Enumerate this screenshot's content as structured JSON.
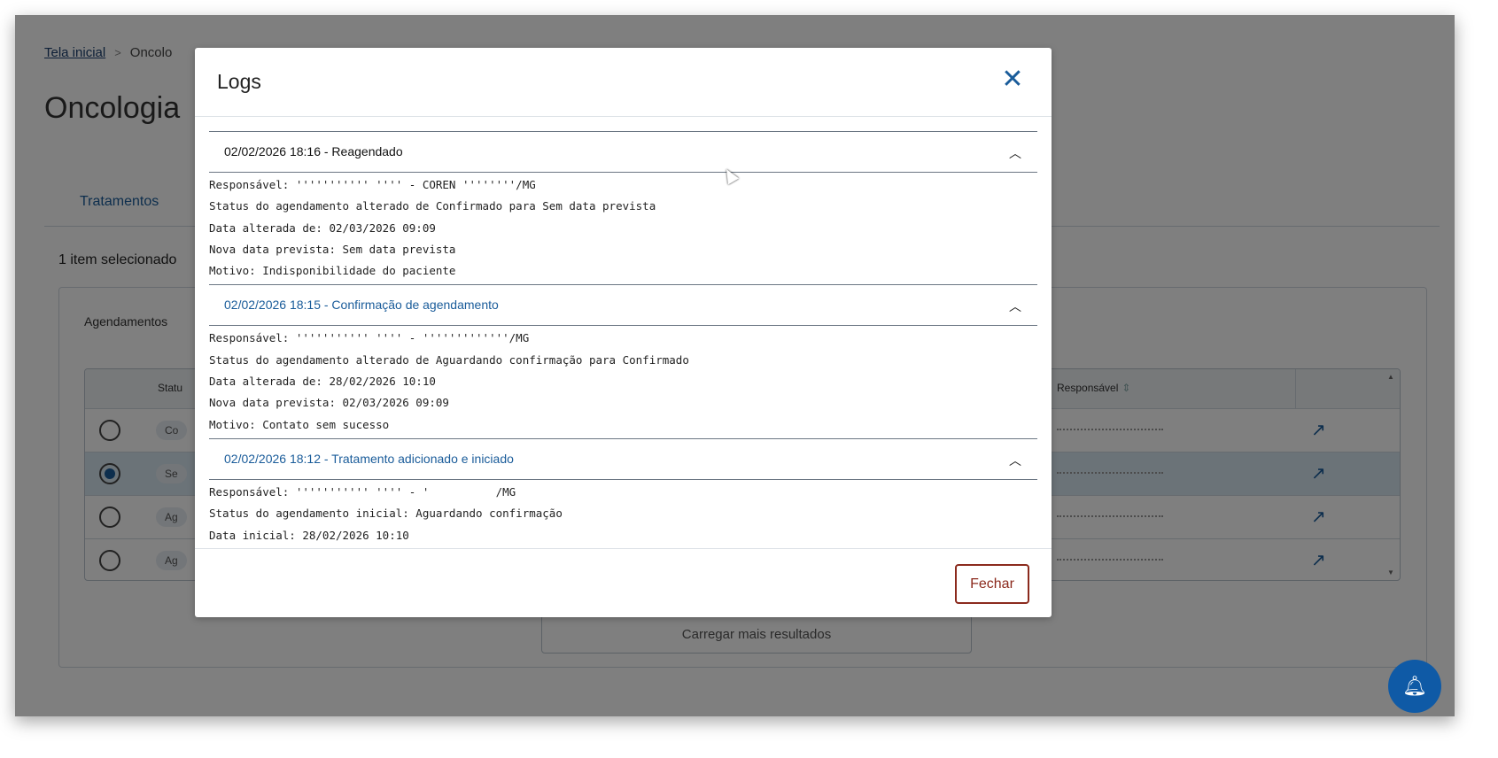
{
  "background": {
    "breadcrumb": {
      "home": "Tela inicial",
      "separator": ">",
      "current": "Oncolo"
    },
    "page_title": "Oncologia",
    "tab": "Tratamentos",
    "selected_count": "1 item selecionado",
    "card_label": "Agendamentos",
    "table": {
      "col_status": "Statu",
      "col_responsavel": "Responsável",
      "rows": [
        {
          "status": "Co",
          "selected": false
        },
        {
          "status": "Se",
          "selected": true
        },
        {
          "status": "Ag",
          "selected": false
        },
        {
          "status": "Ag",
          "selected": false
        }
      ]
    },
    "load_more": "Carregar mais resultados"
  },
  "modal": {
    "title": "Logs",
    "close_icon": "close-icon",
    "entries": [
      {
        "header": "02/02/2026 18:16 - Reagendado",
        "header_style": "dark",
        "lines": [
          "Responsável: ''''''''''' '''' - COREN ''''''''/MG",
          "Status do agendamento alterado de Confirmado para Sem data prevista",
          "Data alterada de: 02/03/2026 09:09",
          "Nova data prevista: Sem data prevista",
          "Motivo: Indisponibilidade do paciente"
        ]
      },
      {
        "header": "02/02/2026 18:15 - Confirmação de agendamento",
        "header_style": "blue",
        "lines": [
          "Responsável: ''''''''''' '''' - '''''''''''''/MG",
          "Status do agendamento alterado de Aguardando confirmação para Confirmado",
          "Data alterada de: 28/02/2026 10:10",
          "Nova data prevista: 02/03/2026 09:09",
          "Motivo: Contato sem sucesso"
        ]
      },
      {
        "header": "02/02/2026 18:12 - Tratamento adicionado e iniciado",
        "header_style": "blue",
        "lines": [
          "Responsável: ''''''''''' '''' - '          /MG",
          "Status do agendamento inicial: Aguardando confirmação",
          "Data inicial: 28/02/2026 10:10"
        ]
      }
    ],
    "close_button": "Fechar"
  }
}
